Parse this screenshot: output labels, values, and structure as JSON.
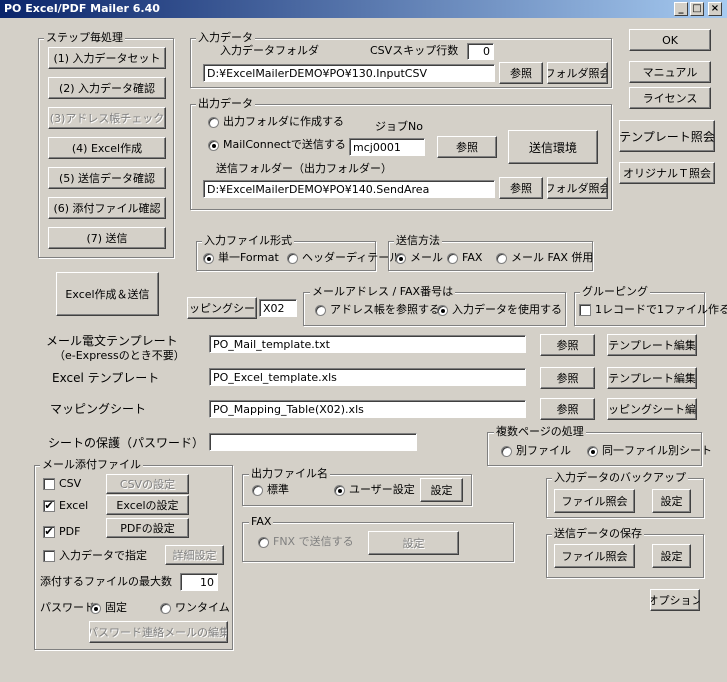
{
  "window": {
    "title": "PO Excel/PDF Mailer 6.40"
  },
  "steps": {
    "group_label": "ステップ毎処理",
    "items": [
      "(1) 入力データセット",
      "(2) 入力データ確認",
      "(3)アドレス帳チェック",
      "(4) Excel作成",
      "(5) 送信データ確認",
      "(6) 添付ファイル確認",
      "(7) 送信"
    ]
  },
  "excel_send_button": "Excel作成＆送信",
  "input_data": {
    "group_label": "入力データ",
    "folder_label": "入力データフォルダ",
    "csv_skip_label": "CSVスキップ行数",
    "csv_skip_value": "0",
    "folder_path": "D:¥ExcelMailerDEMO¥PO¥130.InputCSV",
    "browse_label": "参照",
    "folder_view_label": "フォルダ照会"
  },
  "output_data": {
    "group_label": "出力データ",
    "radio_folder": "出力フォルダに作成する",
    "radio_mailconnect": "MailConnectで送信する",
    "job_no_label": "ジョブNo",
    "job_no_value": "mcj0001",
    "browse_label": "参照",
    "send_env_label": "送信環境",
    "send_folder_label": "送信フォルダー（出力フォルダー）",
    "send_folder_path": "D:¥ExcelMailerDEMO¥PO¥140.SendArea",
    "browse2_label": "参照",
    "folder_view_label": "フォルダ照会"
  },
  "right_buttons": {
    "ok": "OK",
    "manual": "マニュアル",
    "license": "ライセンス",
    "template_view": "テンプレート照会",
    "original_view": "オリジナルＴ照会"
  },
  "input_format": {
    "group_label": "入力ファイル形式",
    "single": "単一Format",
    "header_detail": "ヘッダーディテール"
  },
  "send_method": {
    "group_label": "送信方法",
    "mail": "メール",
    "fax": "FAX",
    "both": "メール FAX 併用"
  },
  "mapping": {
    "button_label": "マッピングシート",
    "value": "X02"
  },
  "address_group": {
    "group_label": "メールアドレス / FAX番号は",
    "opt1": "アドレス帳を参照する",
    "opt2": "入力データを使用する"
  },
  "grouping": {
    "group_label": "グルーピング",
    "check_label": "1レコードで1ファイル作る"
  },
  "templates": {
    "mail_label": "メール電文テンプレート",
    "mail_sub": "（e-Expressのとき不要）",
    "mail_value": "PO_Mail_template.txt",
    "excel_label": "Excel テンプレート",
    "excel_value": "PO_Excel_template.xls",
    "mapping_label": "マッピングシート",
    "mapping_value": "PO_Mapping_Table(X02).xls",
    "browse_label": "参照",
    "template_edit": "テンプレート編集",
    "mapping_edit": "マッピングシート編集"
  },
  "sheet_protect": {
    "label": "シートの保護（パスワード）",
    "value": ""
  },
  "multi_page": {
    "group_label": "複数ページの処理",
    "separate": "別ファイル",
    "same": "同一ファイル別シート"
  },
  "mail_attach": {
    "group_label": "メール添付ファイル",
    "csv": "CSV",
    "csv_settings": "CSVの設定",
    "excel": "Excel",
    "excel_settings": "Excelの設定",
    "pdf": "PDF",
    "pdf_settings": "PDFの設定",
    "input_specify": "入力データで指定",
    "detail_settings": "詳細設定",
    "max_label": "添付するファイルの最大数",
    "max_value": "10",
    "password_label": "パスワード",
    "pw_fixed": "固定",
    "pw_onetime": "ワンタイム",
    "pw_mail_edit": "パスワード連絡メールの編集"
  },
  "output_filename": {
    "group_label": "出力ファイル名",
    "standard": "標準",
    "user": "ユーザー設定",
    "settings": "設定"
  },
  "fax": {
    "group_label": "FAX",
    "fnx": "FNX で送信する",
    "settings": "設定"
  },
  "input_backup": {
    "group_label": "入力データのバックアップ",
    "file_view": "ファイル照会",
    "settings": "設定"
  },
  "send_save": {
    "group_label": "送信データの保存",
    "file_view": "ファイル照会",
    "settings": "設定"
  },
  "options_button": "オプション"
}
